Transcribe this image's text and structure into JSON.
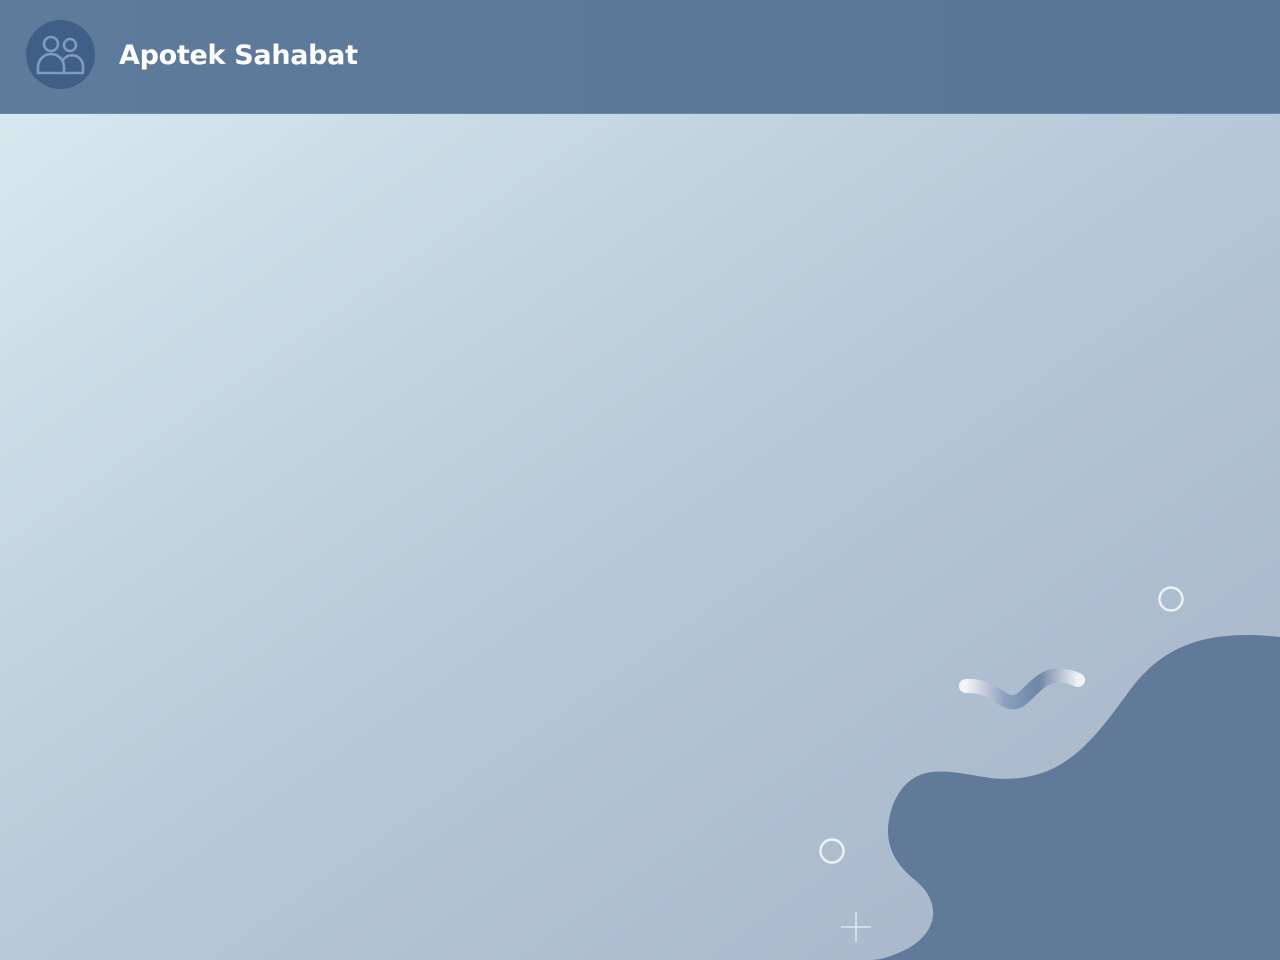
{
  "app": {
    "title": "Apotek Sahabat"
  },
  "header": {
    "logo_icon": "users-group-icon",
    "background_color": "#5c7899"
  },
  "content": {
    "background_start": "#d8e8ef",
    "background_end": "#a5b4c7"
  },
  "decorations": {
    "blob_color": "#627a99",
    "icons": [
      "wave-squiggle-icon",
      "ring-circle-icon",
      "ring-circle-icon",
      "plus-sparkle-icon"
    ]
  }
}
